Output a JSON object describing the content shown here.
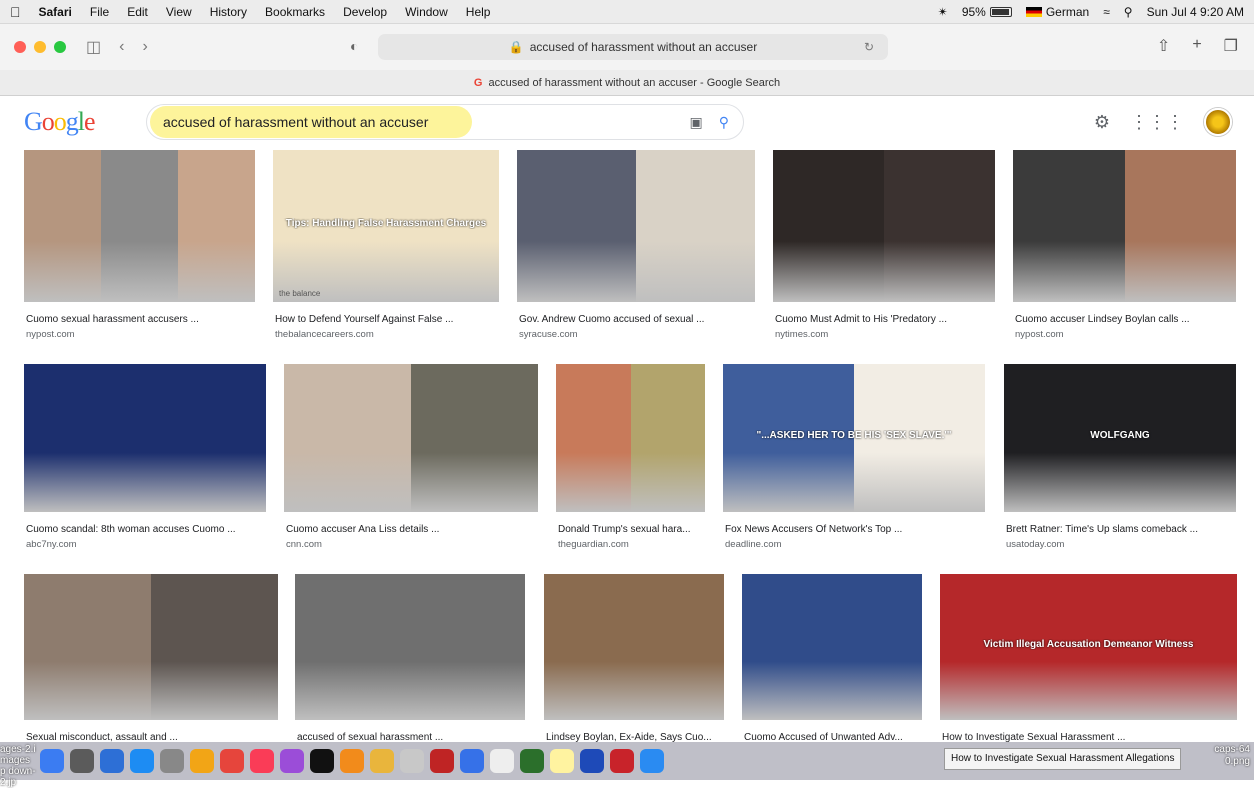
{
  "menubar": {
    "app": "Safari",
    "menus": [
      "File",
      "Edit",
      "View",
      "History",
      "Bookmarks",
      "Develop",
      "Window",
      "Help"
    ],
    "battery": "95%",
    "input_source": "German",
    "datetime": "Sun Jul 4  9:20 AM"
  },
  "browser": {
    "url": "accused of harassment without an accuser",
    "tab_title": "accused of harassment without an accuser - Google Search"
  },
  "google": {
    "query": "accused of harassment without an accuser"
  },
  "results": [
    {
      "caption": "Cuomo sexual harassment accusers ...",
      "source": "nypost.com",
      "colors": [
        "#b5967f",
        "#8a8a8a",
        "#c8a58c"
      ]
    },
    {
      "caption": "How to Defend Yourself Against False ...",
      "source": "thebalancecareers.com",
      "colors": [
        "#efe2c4"
      ],
      "overlay": "Tips: Handling False Harassment Charges",
      "footer": "the balance"
    },
    {
      "caption": "Gov. Andrew Cuomo accused of sexual ...",
      "source": "syracuse.com",
      "colors": [
        "#5a5f70",
        "#d9d2c6"
      ]
    },
    {
      "caption": "Cuomo Must Admit to His 'Predatory ...",
      "source": "nytimes.com",
      "colors": [
        "#2e2826",
        "#3b3230"
      ]
    },
    {
      "caption": "Cuomo accuser Lindsey Boylan calls ...",
      "source": "nypost.com",
      "colors": [
        "#3b3b3b",
        "#a8765c"
      ]
    },
    {
      "caption": "Cuomo scandal: 8th woman accuses Cuomo ...",
      "source": "abc7ny.com",
      "colors": [
        "#1c2f6e"
      ]
    },
    {
      "caption": "Cuomo accuser Ana Liss details ...",
      "source": "cnn.com",
      "colors": [
        "#c9b8a8",
        "#6c6a5e"
      ]
    },
    {
      "caption": "Donald Trump's sexual hara...",
      "source": "theguardian.com",
      "colors": [
        "#c87a5a",
        "#b2a46c"
      ]
    },
    {
      "caption": "Fox News Accusers Of Network's Top ...",
      "source": "deadline.com",
      "colors": [
        "#3f5e9c",
        "#f2ede4"
      ],
      "overlay": "\"...ASKED HER TO BE HIS 'SEX SLAVE.'\""
    },
    {
      "caption": "Brett Ratner: Time's Up slams comeback ...",
      "source": "usatoday.com",
      "colors": [
        "#1f1f22"
      ],
      "overlay": "WOLFGANG"
    },
    {
      "caption": "Sexual misconduct, assault and ...",
      "source": "",
      "colors": [
        "#8e7c6e",
        "#5d5550"
      ]
    },
    {
      "caption": "accused of sexual harassment ...",
      "source": "",
      "colors": [
        "#6f6f6f"
      ]
    },
    {
      "caption": "Lindsey Boylan, Ex-Aide, Says Cuo...",
      "source": "",
      "colors": [
        "#8a6b4f"
      ]
    },
    {
      "caption": "Cuomo Accused of Unwanted Adv...",
      "source": "",
      "colors": [
        "#304c8a"
      ]
    },
    {
      "caption": "How to Investigate Sexual Harassment ...",
      "source": "",
      "colors": [
        "#b5282a"
      ],
      "overlay": "Victim  Illegal  Accusation  Demeanor  Witness"
    }
  ],
  "dock": {
    "tooltip": "How to Investigate Sexual Harassment Allegations",
    "left_label": "ages-2.i mages p down-2.jp",
    "right_label": "caps-64 0.png"
  }
}
